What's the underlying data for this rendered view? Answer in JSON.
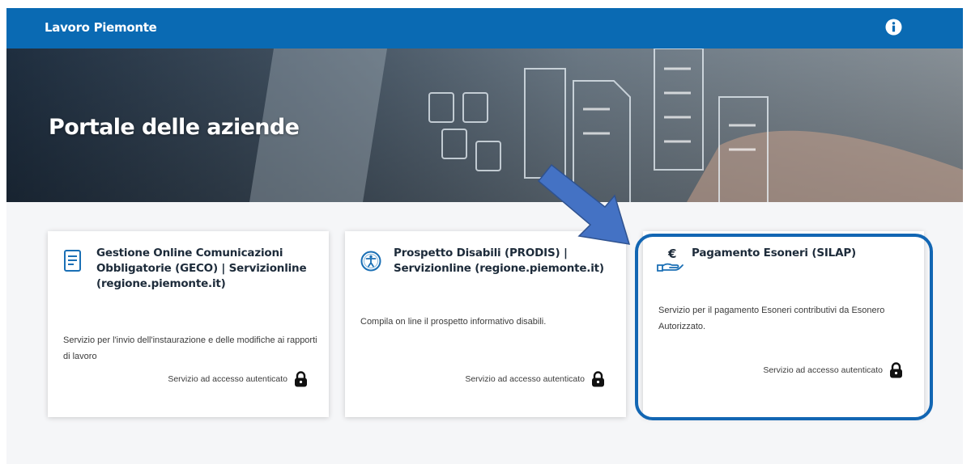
{
  "header": {
    "brand": "Lavoro Piemonte",
    "info_icon": "info-icon",
    "color": "#0a6ab3"
  },
  "hero": {
    "title": "Portale delle aziende"
  },
  "cards": [
    {
      "icon": "document-icon",
      "title": "Gestione Online Comunicazioni Obbligatorie (GECO) | Servizionline (regione.piemonte.it)",
      "description": "Servizio per l'invio dell'instaurazione e delle modifiche ai rapporti di lavoro",
      "access": "Servizio ad accesso autenticato",
      "access_icon": "lock-icon"
    },
    {
      "icon": "accessibility-icon",
      "title": "Prospetto Disabili (PRODIS) | Servizionline (regione.piemonte.it)",
      "description": "Compila on line il prospetto informativo disabili.",
      "access": "Servizio ad accesso autenticato",
      "access_icon": "lock-icon"
    },
    {
      "icon": "euro-hand-icon",
      "title": "Pagamento Esoneri (SILAP)",
      "description": "Servizio per il pagamento Esoneri contributivi da Esonero Autorizzato.",
      "access": "Servizio ad accesso autenticato",
      "access_icon": "lock-icon"
    }
  ],
  "annotation": {
    "arrow_color": "#4472c4",
    "highlight_color": "#1266b3"
  }
}
